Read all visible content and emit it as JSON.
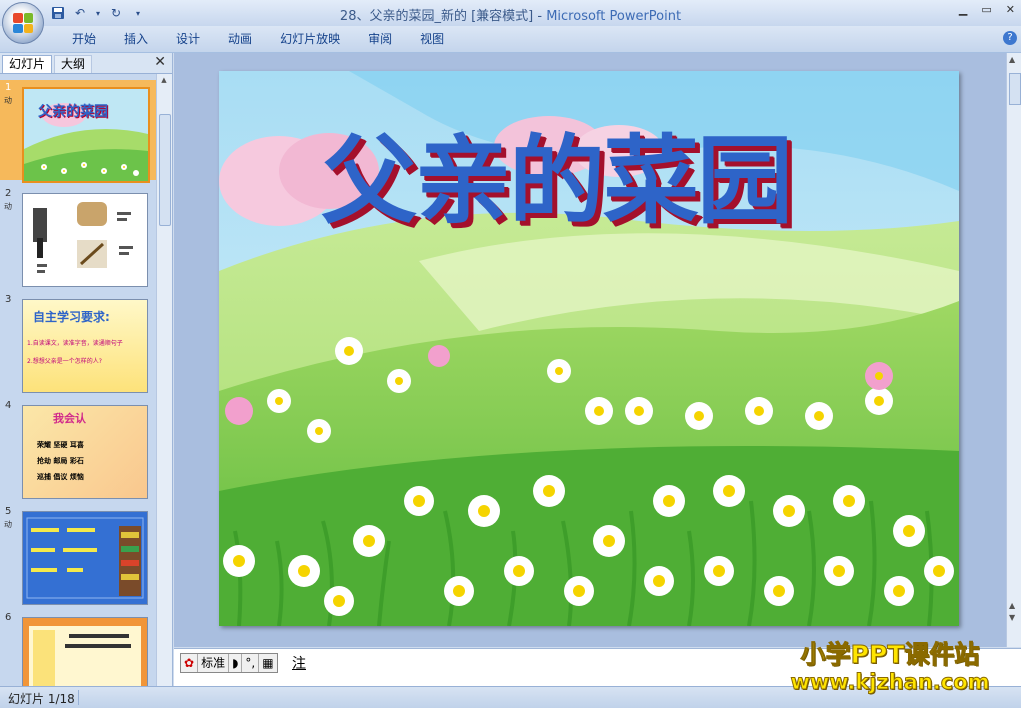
{
  "window": {
    "title": "28、父亲的菜园_新的 [兼容模式] - ",
    "app_name": "Microsoft PowerPoint"
  },
  "quick_access": {
    "save_icon": "save-icon",
    "undo_icon": "undo-icon",
    "redo_icon": "redo-icon",
    "customize_icon": "dropdown-icon"
  },
  "menu": {
    "items": [
      "开始",
      "插入",
      "设计",
      "动画",
      "幻灯片放映",
      "审阅",
      "视图"
    ]
  },
  "left_pane": {
    "tabs": [
      "幻灯片",
      "大纲"
    ],
    "thumbnails": [
      {
        "num": "1",
        "anim": "动",
        "title": "父亲的菜园"
      },
      {
        "num": "2",
        "anim": "动",
        "title": ""
      },
      {
        "num": "3",
        "anim": "",
        "title": "自主学习要求:",
        "lines": [
          "1.自读课文，读准字音，读通顺句子",
          "2.想想父亲是一个怎样的人?"
        ]
      },
      {
        "num": "4",
        "anim": "",
        "title": "我会认",
        "words": [
          "荣耀 坚硬 耳喜",
          "抢劫 邮局 彩石",
          "巡捕 倡议 烦恼"
        ]
      },
      {
        "num": "5",
        "anim": "动",
        "title": ""
      },
      {
        "num": "6",
        "anim": "",
        "title": ""
      }
    ]
  },
  "slide": {
    "title": "父亲的菜园"
  },
  "notes": {
    "ime_mode": "标准",
    "text": "注"
  },
  "status": {
    "slide_counter": "幻灯片 1/18"
  },
  "watermark": {
    "line1": "小学PPT课件站",
    "line2": "www.kjzhan.com"
  },
  "colors": {
    "accent": "#15428b",
    "selected_thumb": "#f6b95b",
    "title_blue": "#2e64c8"
  }
}
